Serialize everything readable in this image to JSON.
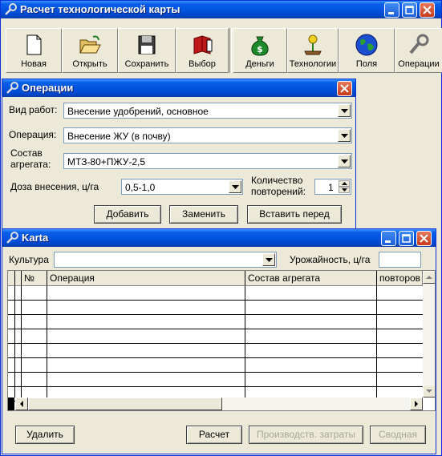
{
  "main_window": {
    "title": "Расчет технологической карты",
    "toolbar": [
      {
        "label": "Новая",
        "icon": "new-document-icon"
      },
      {
        "label": "Открыть",
        "icon": "open-folder-icon"
      },
      {
        "label": "Сохранить",
        "icon": "floppy-disk-icon"
      },
      {
        "label": "Выбор",
        "icon": "book-icon"
      },
      {
        "label": "Деньги",
        "icon": "money-bag-icon"
      },
      {
        "label": "Технологии",
        "icon": "plant-icon"
      },
      {
        "label": "Поля",
        "icon": "globe-icon"
      },
      {
        "label": "Операции",
        "icon": "wrench-icon"
      }
    ]
  },
  "operations_window": {
    "title": "Операции",
    "work_type": {
      "label": "Вид работ:",
      "value": "Внесение удобрений, основное"
    },
    "operation": {
      "label": "Операция:",
      "value": "Внесение ЖУ (в почву)"
    },
    "unit": {
      "label": "Состав агрегата:",
      "value": "МТЗ-80+ПЖУ-2,5"
    },
    "dose": {
      "label": "Доза внесения, ц/га",
      "value": "0,5-1,0"
    },
    "repeats": {
      "label": "Количество повторений:",
      "value": "1"
    },
    "buttons": {
      "add": "Добавить",
      "replace": "Заменить",
      "insert_before": "Вставить перед"
    }
  },
  "karta_window": {
    "title": "Karta",
    "culture": {
      "label": "Культура",
      "value": ""
    },
    "yield": {
      "label": "Урожайность, ц/га",
      "value": ""
    },
    "columns": [
      "№",
      "Операция",
      "Состав агрегата",
      "повторов"
    ],
    "buttons": {
      "delete": "Удалить",
      "calc": "Расчет",
      "costs": "Производств. затраты",
      "summary": "Сводная"
    }
  },
  "colors": {
    "title_bar": "#0054e3",
    "window_bg": "#ece9d8",
    "disabled_text": "#a7a697"
  }
}
